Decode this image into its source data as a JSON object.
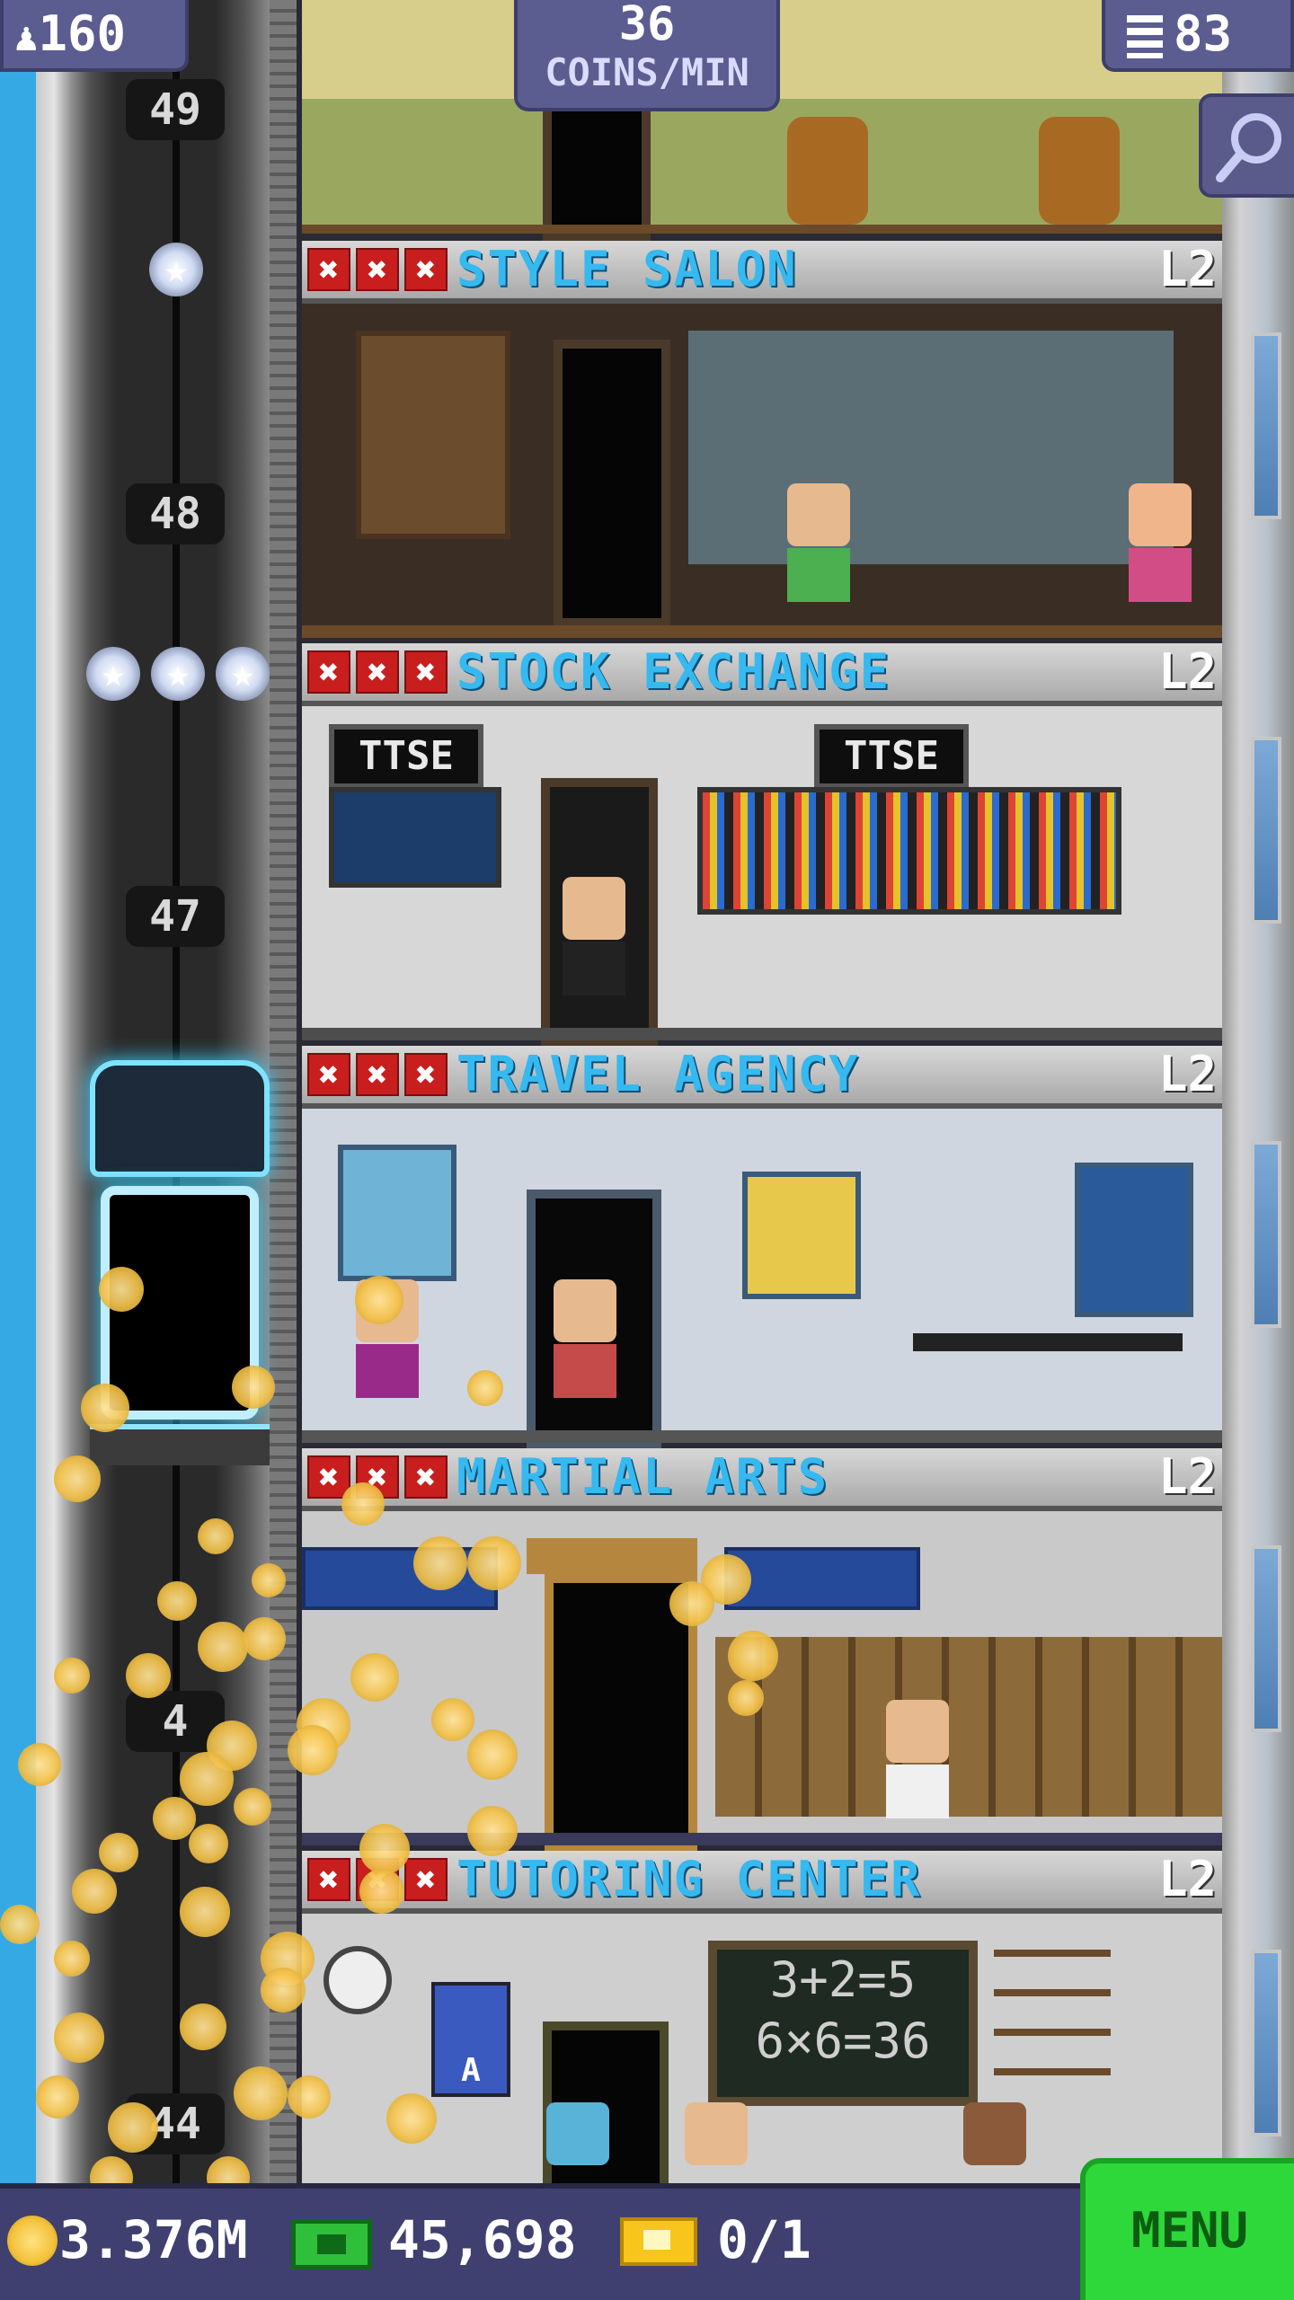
{
  "hud": {
    "population": "160",
    "coins_per_min_value": "36",
    "coins_per_min_unit": "COINS/MIN",
    "floor_count": "83"
  },
  "shaft": {
    "floor_numbers": [
      "49",
      "48",
      "47",
      "4",
      "44"
    ]
  },
  "rooms": [
    {
      "name": "STYLE SALON",
      "level": "L2",
      "x_marks": [
        "✖",
        "✖",
        "✖"
      ]
    },
    {
      "name": "STOCK EXCHANGE",
      "level": "L2",
      "x_marks": [
        "✖",
        "✖",
        "✖"
      ]
    },
    {
      "name": "TRAVEL AGENCY",
      "level": "L2",
      "x_marks": [
        "✖",
        "✖",
        "✖"
      ]
    },
    {
      "name": "MARTIAL ARTS",
      "level": "L2",
      "x_marks": [
        "✖",
        "✖",
        "✖"
      ]
    },
    {
      "name": "TUTORING CENTER",
      "level": "L2",
      "x_marks": [
        "✖",
        "✖",
        "✖"
      ]
    }
  ],
  "room_decor": {
    "ttse_left": "TTSE",
    "ttse_right": "TTSE",
    "chalk_line1": "3+2=5",
    "chalk_line2": "6×6=36",
    "poster_letter": "A"
  },
  "bottom": {
    "coins": "3.376M",
    "bux": "45,698",
    "tickets": "0/1",
    "menu_label": "MENU"
  },
  "icons": {
    "population": "person-icon",
    "floors": "building-icon",
    "zoom": "magnifier-icon",
    "coin": "coin-icon",
    "bux": "bux-icon",
    "ticket": "ticket-icon"
  },
  "colors": {
    "room_name": "#35b9f0",
    "x_mark": "#c81e1e",
    "menu_button": "#2fd83a",
    "hud_panel": "#5b5c90",
    "elevator_glow": "#7fe3ff"
  }
}
